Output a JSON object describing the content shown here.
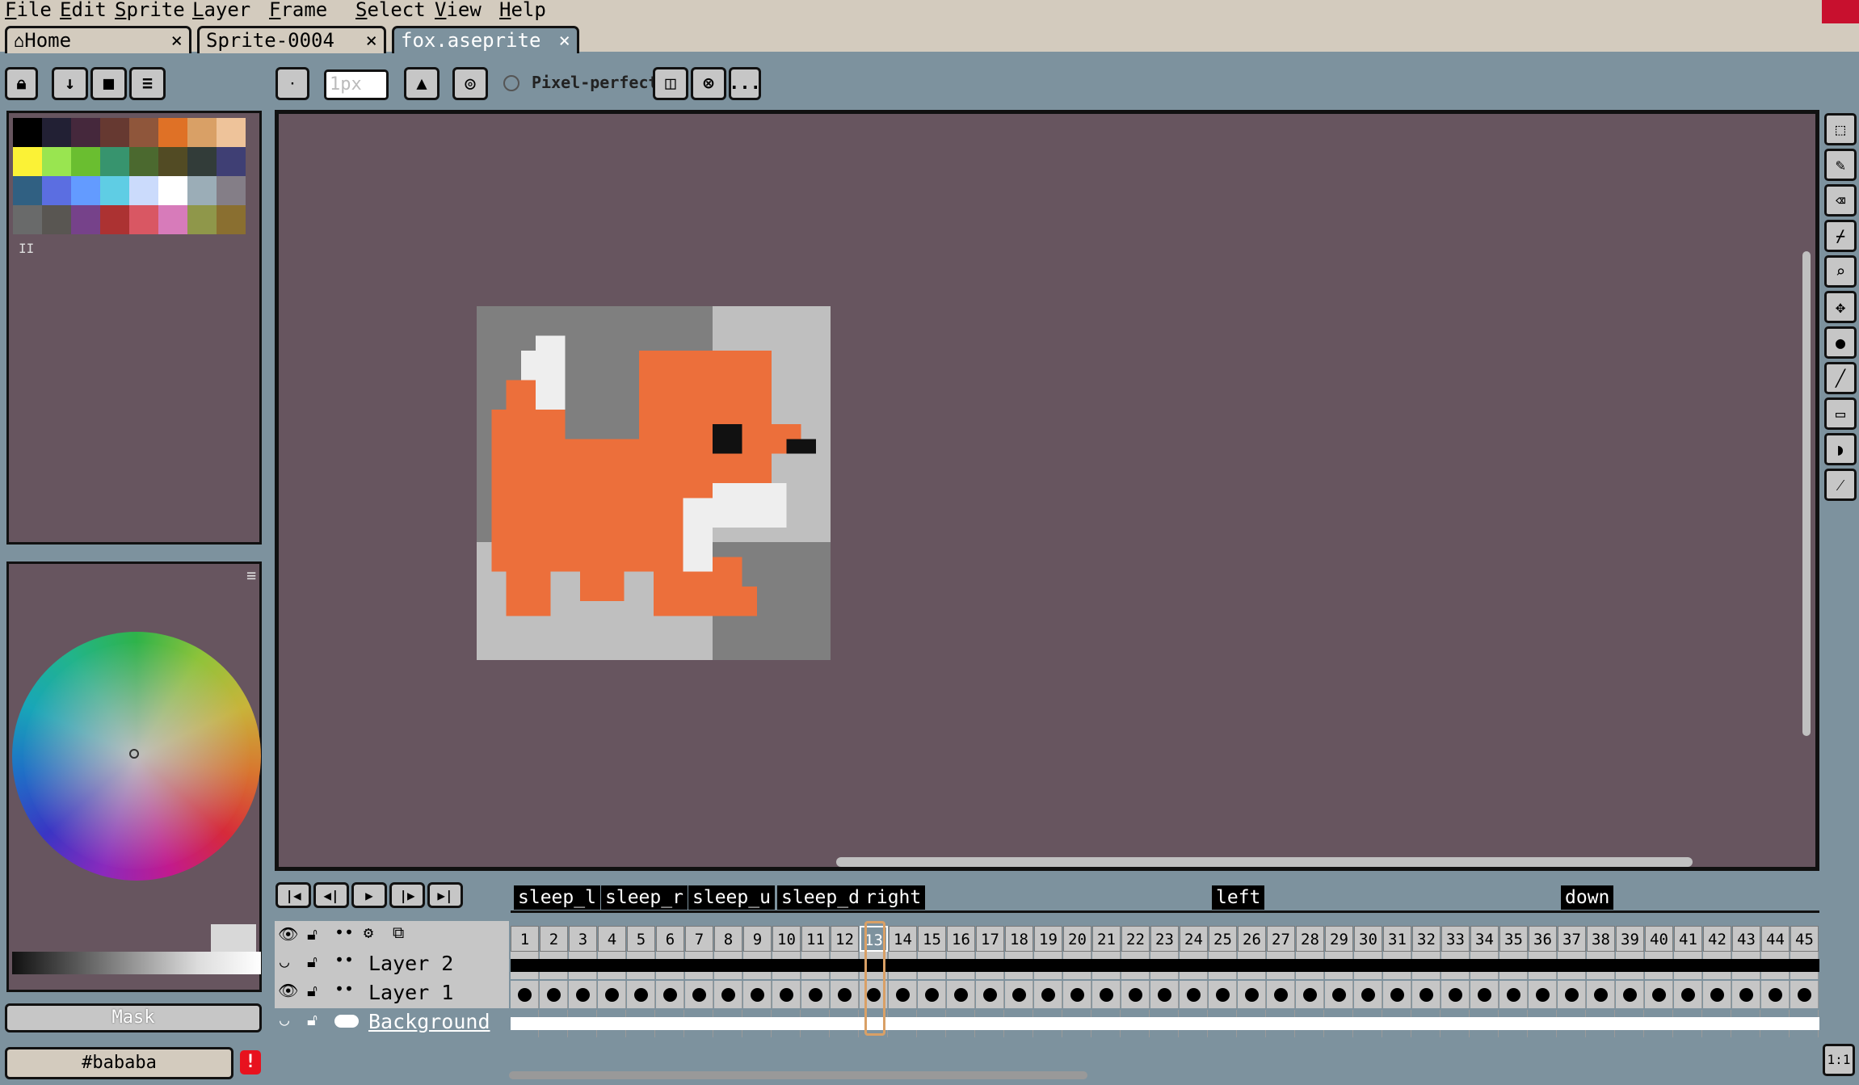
{
  "menu": [
    {
      "label": "File",
      "u": "F",
      "rest": "ile"
    },
    {
      "label": "Edit",
      "u": "E",
      "rest": "dit"
    },
    {
      "label": "Sprite",
      "u": "S",
      "rest": "prite"
    },
    {
      "label": "Layer",
      "u": "L",
      "rest": "ayer"
    },
    {
      "label": "Frame",
      "u": "F",
      "rest": "rame"
    },
    {
      "label": "Select",
      "u": "S",
      "rest": "elect"
    },
    {
      "label": "View",
      "u": "V",
      "rest": "iew"
    },
    {
      "label": "Help",
      "u": "H",
      "rest": "elp"
    }
  ],
  "tabs": [
    {
      "label": "Home",
      "close": "×"
    },
    {
      "label": "Sprite-0004",
      "close": "×"
    },
    {
      "label": "fox.aseprite",
      "close": "×"
    }
  ],
  "toolbar": {
    "brush_size_placeholder": "1px",
    "pixel_perfect_label": "Pixel-perfect",
    "more_label": "..."
  },
  "palette": {
    "colors": [
      "#000000",
      "#222034",
      "#45283c",
      "#663931",
      "#8f563b",
      "#df7126",
      "#d9a066",
      "#eec39a",
      "#fbf236",
      "#99e550",
      "#6abe30",
      "#37946e",
      "#4b692f",
      "#524b24",
      "#323c39",
      "#3f3f74",
      "#306082",
      "#5b6ee1",
      "#639bff",
      "#5fcde4",
      "#cbdbfc",
      "#ffffff",
      "#9badb7",
      "#847e87",
      "#696a6a",
      "#595652",
      "#76428a",
      "#ac3232",
      "#d95763",
      "#d77bba",
      "#8f974a",
      "#8a6f30"
    ],
    "resize_hint": "II"
  },
  "color_bar": {
    "mask_label": "Mask",
    "hex_value": "#bababa",
    "warning": "!"
  },
  "timeline": {
    "layers": [
      "Layer 2",
      "Layer 1",
      "Background"
    ],
    "tags": [
      {
        "label": "sleep_l"
      },
      {
        "label": "sleep_r"
      },
      {
        "label": "sleep_u"
      },
      {
        "label": "sleep_d"
      },
      {
        "label": "right"
      },
      {
        "label": "left"
      },
      {
        "label": "down"
      }
    ],
    "frames": [
      "1",
      "2",
      "3",
      "4",
      "5",
      "6",
      "7",
      "8",
      "9",
      "10",
      "11",
      "12",
      "13",
      "14",
      "15",
      "16",
      "17",
      "18",
      "19",
      "20",
      "21",
      "22",
      "23",
      "24",
      "25",
      "26",
      "27",
      "28",
      "29",
      "30",
      "31",
      "32",
      "33",
      "34",
      "35",
      "36",
      "37",
      "38",
      "39",
      "40",
      "41",
      "42",
      "43",
      "44",
      "45"
    ],
    "current_frame": 13,
    "zoom_label": "1:1"
  },
  "colors": {
    "workspace": "#7d929e",
    "canvas_bg": "#67555f",
    "fox_orange": "#ec6f3b"
  }
}
